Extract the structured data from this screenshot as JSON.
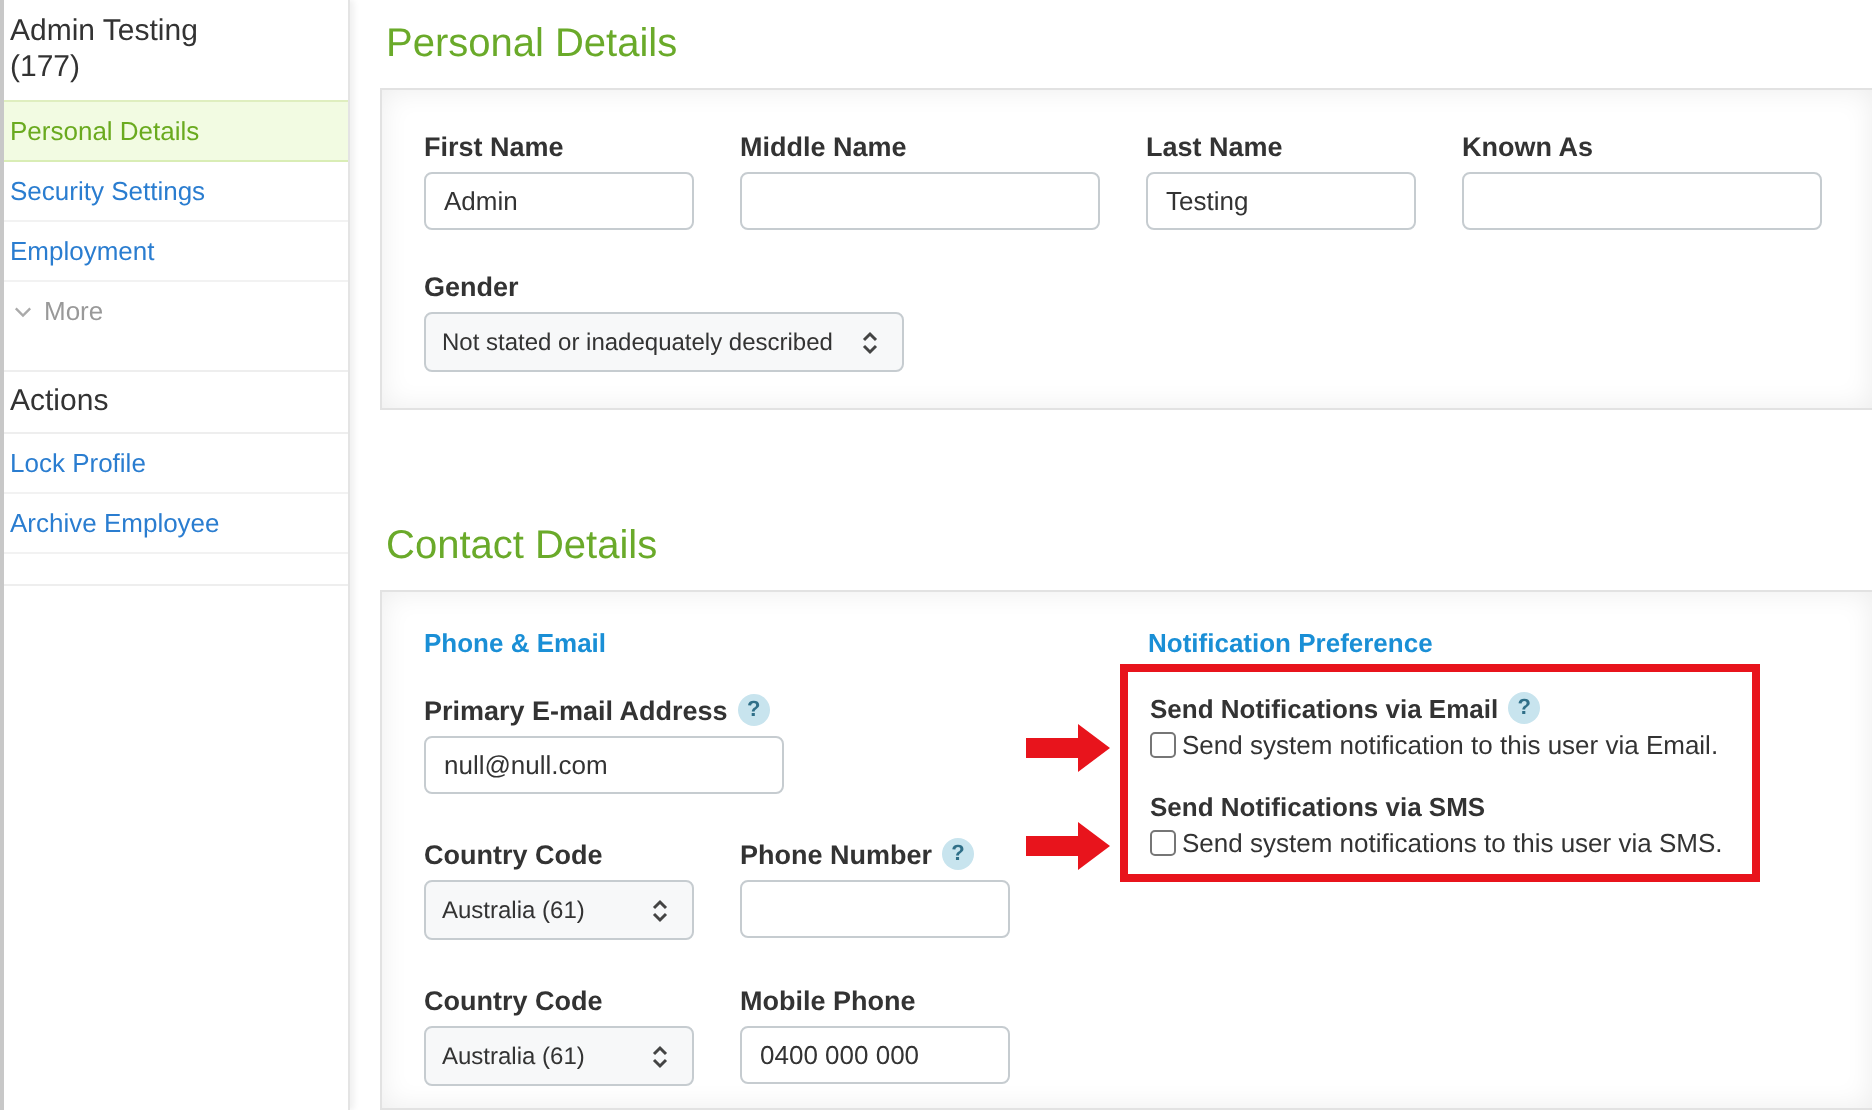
{
  "sidebar": {
    "title": "Admin Testing (177)",
    "nav": [
      {
        "label": "Personal Details",
        "selected": true
      },
      {
        "label": "Security Settings",
        "selected": false
      },
      {
        "label": "Employment",
        "selected": false
      }
    ],
    "more": "More",
    "actions_heading": "Actions",
    "actions": [
      "Lock Profile",
      "Archive Employee"
    ]
  },
  "personal_details": {
    "heading": "Personal Details",
    "fields": [
      {
        "label": "First Name",
        "kind": "text",
        "value": "Admin"
      },
      {
        "label": "Middle Name",
        "kind": "text"
      },
      {
        "label": "Last Name",
        "kind": "text",
        "value": "Testing"
      },
      {
        "label": "Known As",
        "kind": "text"
      },
      {
        "label": "Gender",
        "kind": "select",
        "value": "Not stated or inadequately described"
      }
    ]
  },
  "contact_details": {
    "heading": "Contact Details",
    "phone_email": {
      "heading": "Phone & Email",
      "fields": [
        {
          "label": "Primary E-mail Address",
          "kind": "text",
          "value": "null@null.com",
          "help": "?"
        },
        {
          "label": "Country Code",
          "kind": "select",
          "value": "Australia (61)"
        },
        {
          "label": "Phone Number",
          "kind": "text",
          "help": "?"
        },
        {
          "label": "Country Code",
          "kind": "select",
          "value": "Australia (61)"
        },
        {
          "label": "Mobile Phone",
          "kind": "text",
          "value": "0400 000 000"
        }
      ]
    },
    "notification": {
      "heading": "Notification Preference",
      "options": [
        {
          "title": "Send Notifications via Email",
          "help": "?",
          "label": "Send system notification to this user via Email.",
          "checked": false
        },
        {
          "title": "Send Notifications via SMS",
          "label": "Send system notifications to this user via SMS.",
          "checked": false
        }
      ]
    }
  }
}
